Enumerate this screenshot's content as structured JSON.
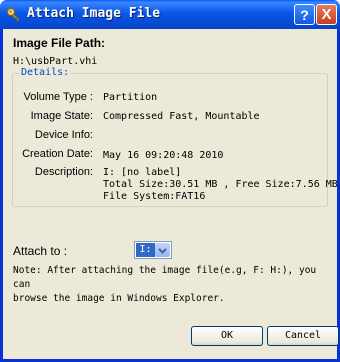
{
  "window": {
    "title": "Attach Image File",
    "help_label": "?",
    "close_label": "X"
  },
  "image_path": {
    "label": "Image File Path:",
    "value": "H:\\usbPart.vhi"
  },
  "details": {
    "legend": "Details:",
    "rows": [
      {
        "label": "Volume Type :",
        "value": "Partition"
      },
      {
        "label": "Image State:",
        "value": "Compressed Fast, Mountable"
      },
      {
        "label": "Device Info:",
        "value": ""
      },
      {
        "label": "Creation Date:",
        "value": "May 16 09:20:48 2010"
      },
      {
        "label": "Description:",
        "lines": [
          "I: [no label]",
          "Total Size:30.51 MB , Free Size:7.56 MB,",
          "File System:FAT16"
        ]
      }
    ]
  },
  "attach": {
    "label": "Attach to :",
    "selected": "I:"
  },
  "note": {
    "lines": [
      "Note: After attaching the image file(e.g, F: H:), you can",
      "browse the image in Windows Explorer."
    ]
  },
  "buttons": {
    "ok": "OK",
    "cancel": "Cancel"
  },
  "colors": {
    "titlebar": "#0a57e8",
    "window_bg": "#ece9d8",
    "legend": "#0046d5",
    "selection": "#316ac5"
  },
  "icons": {
    "title": "key-icon",
    "dropdown": "chevron-down-icon"
  }
}
